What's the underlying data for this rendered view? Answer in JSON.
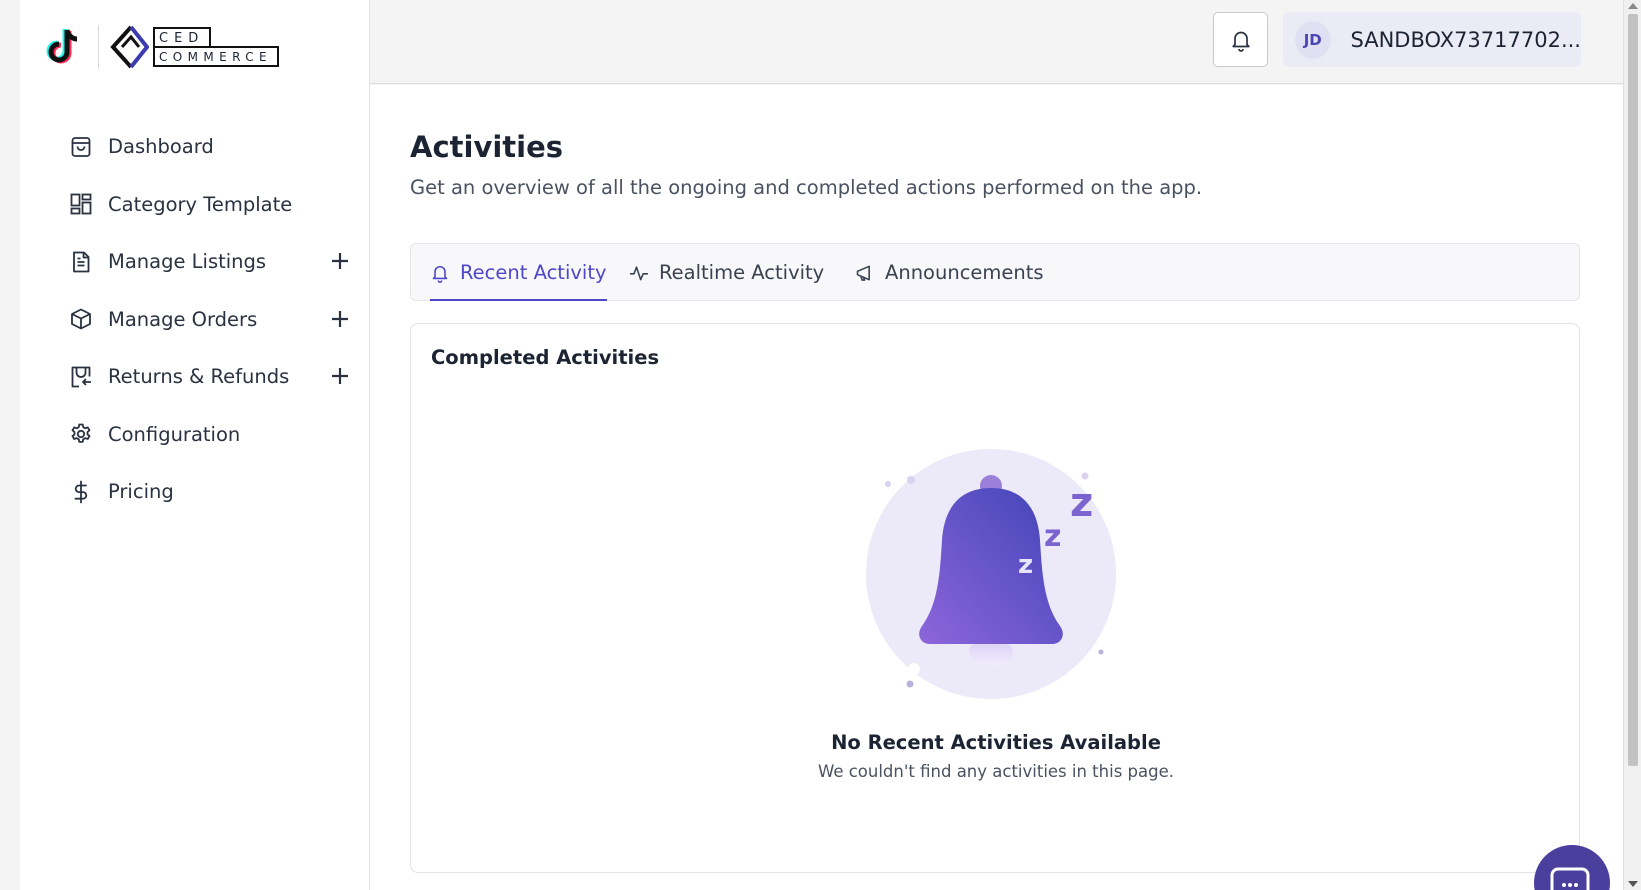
{
  "brand": {
    "logo_top": "CED",
    "logo_bottom": "COMMERCE"
  },
  "sidebar": {
    "items": [
      {
        "label": "Dashboard",
        "icon": "shopping-bag-icon",
        "expandable": false
      },
      {
        "label": "Category Template",
        "icon": "layout-grid-icon",
        "expandable": false
      },
      {
        "label": "Manage Listings",
        "icon": "document-icon",
        "expandable": true
      },
      {
        "label": "Manage Orders",
        "icon": "package-box-icon",
        "expandable": true
      },
      {
        "label": "Returns & Refunds",
        "icon": "return-icon",
        "expandable": true
      },
      {
        "label": "Configuration",
        "icon": "gear-icon",
        "expandable": false
      },
      {
        "label": "Pricing",
        "icon": "dollar-icon",
        "expandable": false
      }
    ]
  },
  "header": {
    "avatar_initials": "JD",
    "account_name": "SANDBOX73717702..."
  },
  "page": {
    "title": "Activities",
    "subtitle": "Get an overview of all the ongoing and completed actions performed on the app.",
    "tabs": [
      {
        "label": "Recent Activity",
        "icon": "bell-icon",
        "active": true
      },
      {
        "label": "Realtime Activity",
        "icon": "activity-pulse-icon",
        "active": false
      },
      {
        "label": "Announcements",
        "icon": "megaphone-icon",
        "active": false
      }
    ],
    "card": {
      "title": "Completed Activities",
      "empty_title": "No Recent Activities Available",
      "empty_description": "We couldn't find any activities in this page."
    }
  },
  "colors": {
    "accent": "#4e47c9",
    "sidebar_bg": "#ffffff",
    "page_bg": "#f4f4f5",
    "bell_gradient_start": "#8a64d8",
    "bell_gradient_end": "#3f44b8"
  }
}
